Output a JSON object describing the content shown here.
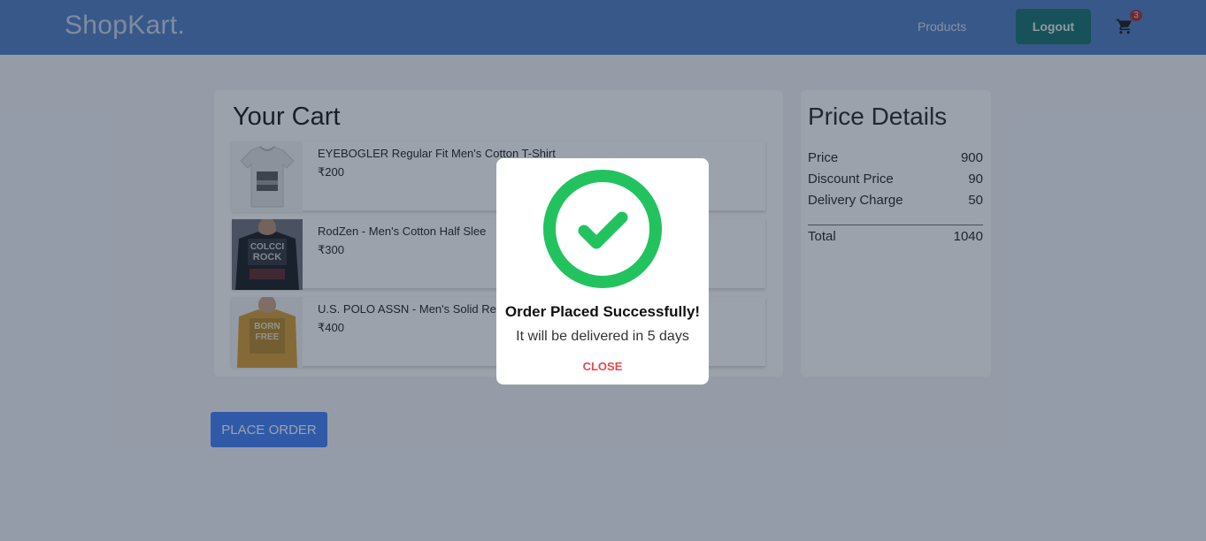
{
  "navbar": {
    "brand": "ShopKart.",
    "products_link": "Products",
    "logout_label": "Logout",
    "cart_count": "3",
    "cart_icon": "shopping-cart-icon",
    "background": "#4a79c0"
  },
  "cart": {
    "title": "Your Cart",
    "items": [
      {
        "name": "EYEBOGLER Regular Fit Men's Cotton T-Shirt",
        "price": "₹200",
        "image": "grey-tshirt-image"
      },
      {
        "name": "RodZen - Men's Cotton Half Slee",
        "price": "₹300",
        "image": "black-tshirt-image"
      },
      {
        "name": "U.S. POLO ASSN - Men's Solid Re",
        "price": "₹400",
        "image": "mustard-tshirt-image"
      }
    ]
  },
  "price_details": {
    "title": "Price Details",
    "rows": [
      {
        "label": "Price",
        "value": "900"
      },
      {
        "label": "Discount Price",
        "value": "90"
      },
      {
        "label": "Delivery Charge",
        "value": "50"
      }
    ],
    "total_label": "Total",
    "total_value": "1040"
  },
  "place_order_label": "PLACE ORDER",
  "modal": {
    "heading": "Order Placed Successfully!",
    "message": "It will be delivered in 5 days",
    "close_label": "CLOSE",
    "icon": "check-circle-icon",
    "accent": "#22c35e"
  },
  "colors": {
    "primary_button": "#3b7cf6",
    "logout_button": "#0e6d6a",
    "close_text": "#e24a4a"
  }
}
